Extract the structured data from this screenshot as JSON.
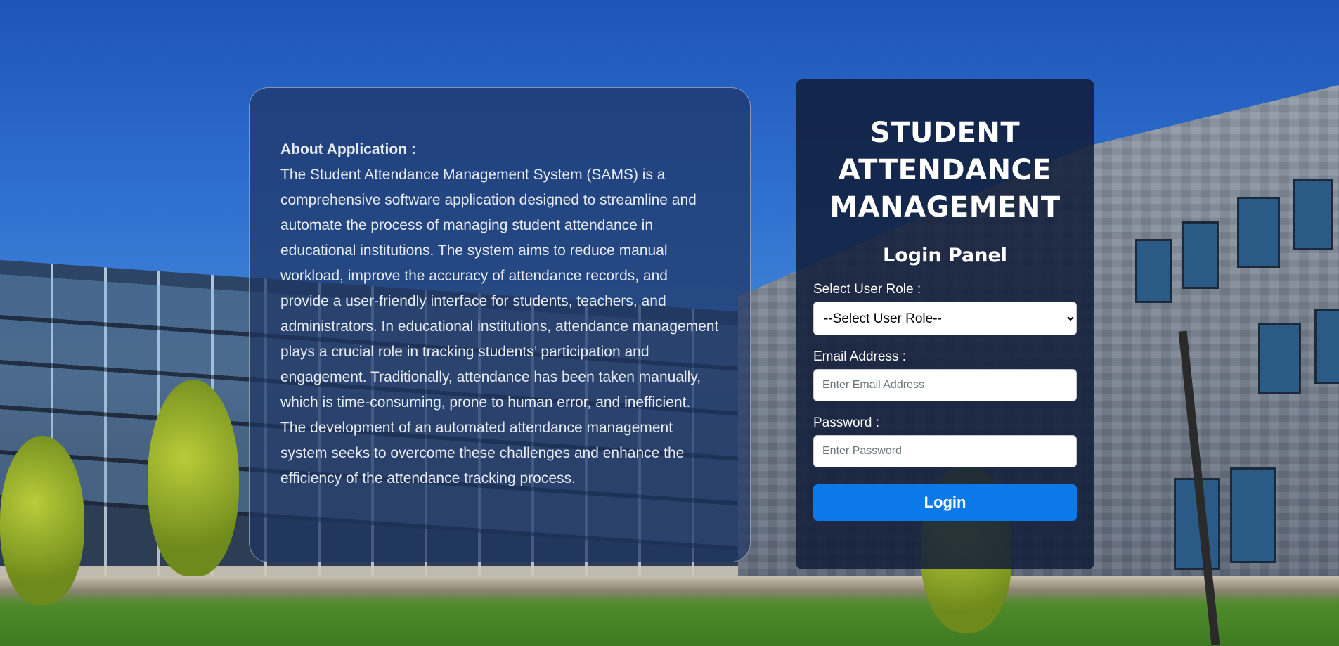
{
  "about": {
    "title": "About Application :",
    "text": "The Student Attendance Management System (SAMS) is a comprehensive software application designed to streamline and automate the process of managing student attendance in educational institutions. The system aims to reduce manual workload, improve the accuracy of attendance records, and provide a user-friendly interface for students, teachers, and administrators. In educational institutions, attendance management plays a crucial role in tracking students’ participation and engagement. Traditionally, attendance has been taken manually, which is time-consuming, prone to human error, and inefficient. The development of an automated attendance management system seeks to overcome these challenges and enhance the efficiency of the attendance tracking process."
  },
  "login": {
    "app_title": "STUDENT ATTENDANCE MANAGEMENT",
    "panel_title": "Login Panel",
    "role_label": "Select User Role :",
    "role_selected": "--Select User Role--",
    "email_label": "Email Address :",
    "email_placeholder": "Enter Email Address",
    "password_label": "Password :",
    "password_placeholder": "Enter Password",
    "button_label": "Login",
    "button_color": "#0b79e8"
  }
}
